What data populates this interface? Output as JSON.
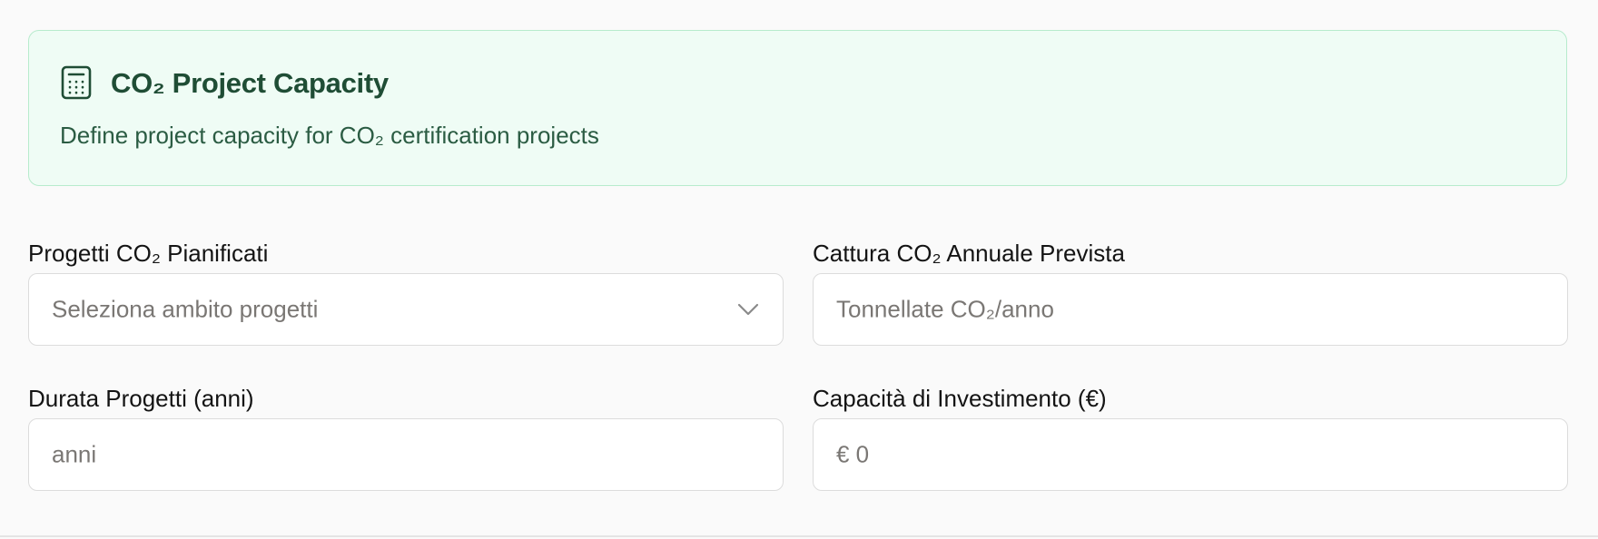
{
  "info_card": {
    "icon": "calculator-icon",
    "title": "CO₂ Project Capacity",
    "subtitle": "Define project capacity for CO₂ certification projects"
  },
  "form": {
    "planned_projects": {
      "label": "Progetti CO₂ Pianificati",
      "placeholder": "Seleziona ambito progetti"
    },
    "annual_capture": {
      "label": "Cattura CO₂ Annuale Prevista",
      "placeholder": "Tonnellate CO₂/anno"
    },
    "duration": {
      "label": "Durata Progetti (anni)",
      "placeholder": "anni"
    },
    "investment": {
      "label": "Capacità di Investimento (€)",
      "placeholder": "€ 0"
    }
  },
  "colors": {
    "card_background": "#effcf5",
    "card_border": "#b7ebcd",
    "card_title": "#1f4d35",
    "placeholder": "#7a7774"
  }
}
